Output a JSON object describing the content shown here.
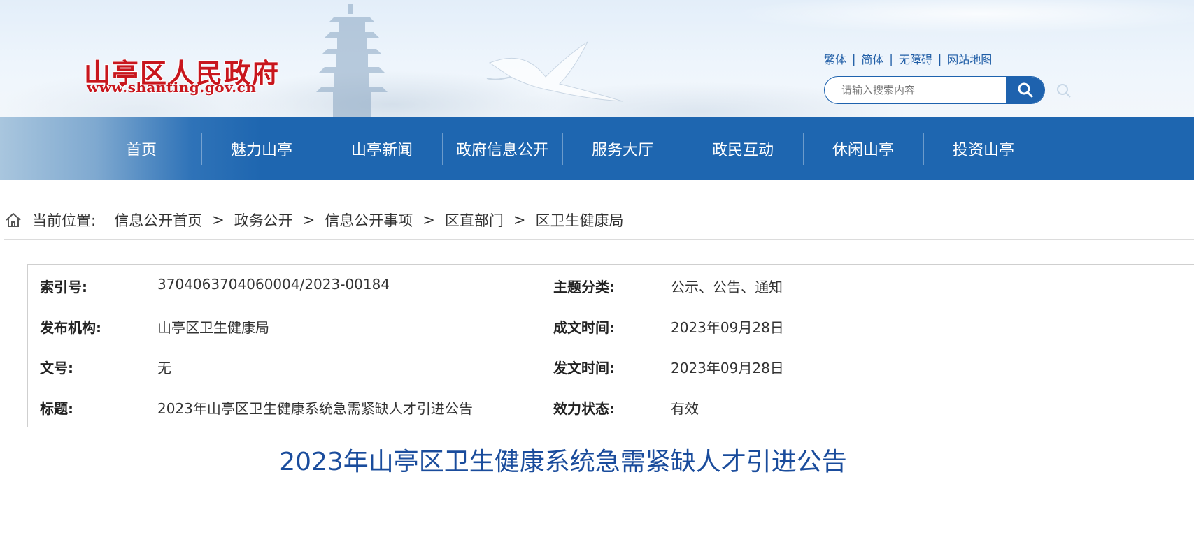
{
  "header": {
    "site_title": "山亭区人民政府",
    "site_url": "www.shanting.gov.cn",
    "top_links": [
      "繁体",
      "简体",
      "无障碍",
      "网站地图"
    ],
    "search_placeholder": "请输入搜索内容"
  },
  "nav": {
    "items": [
      "首页",
      "魅力山亭",
      "山亭新闻",
      "政府信息公开",
      "服务大厅",
      "政民互动",
      "休闲山亭",
      "投资山亭"
    ]
  },
  "breadcrumb": {
    "label": "当前位置:",
    "items": [
      "信息公开首页",
      "政务公开",
      "信息公开事项",
      "区直部门",
      "区卫生健康局"
    ],
    "separator": ">"
  },
  "info": {
    "rows": [
      {
        "label1": "索引号:",
        "value1": "3704063704060004/2023-00184",
        "label2": "主题分类:",
        "value2": "公示、公告、通知"
      },
      {
        "label1": "发布机构:",
        "value1": "山亭区卫生健康局",
        "label2": "成文时间:",
        "value2": "2023年09月28日"
      },
      {
        "label1": "文号:",
        "value1": "无",
        "label2": "发文时间:",
        "value2": "2023年09月28日"
      },
      {
        "label1": "标题:",
        "value1": "2023年山亭区卫生健康系统急需紧缺人才引进公告",
        "label2": "效力状态:",
        "value2": "有效"
      }
    ]
  },
  "article": {
    "title": "2023年山亭区卫生健康系统急需紧缺人才引进公告"
  },
  "colors": {
    "brand_red": "#c8161d",
    "nav_blue": "#1e66b0",
    "title_blue": "#1a4c9c",
    "link_blue": "#1f5da6"
  }
}
